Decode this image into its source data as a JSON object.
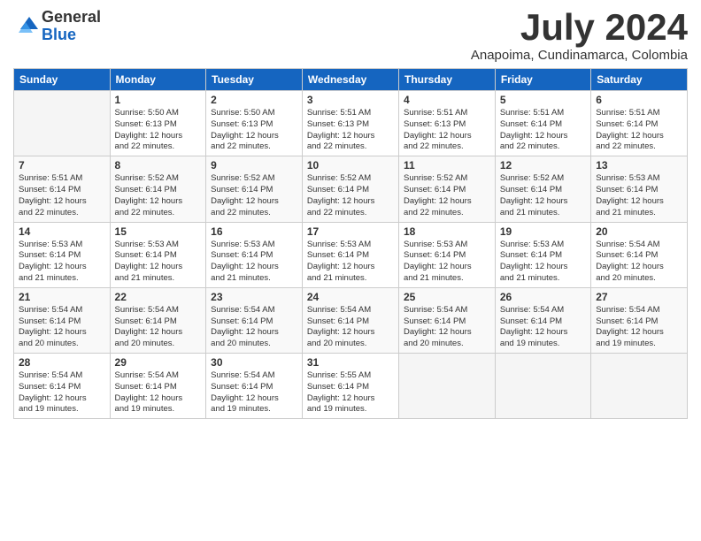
{
  "logo": {
    "general": "General",
    "blue": "Blue"
  },
  "header": {
    "month": "July 2024",
    "location": "Anapoima, Cundinamarca, Colombia"
  },
  "days_of_week": [
    "Sunday",
    "Monday",
    "Tuesday",
    "Wednesday",
    "Thursday",
    "Friday",
    "Saturday"
  ],
  "weeks": [
    [
      {
        "day": "",
        "info": ""
      },
      {
        "day": "1",
        "info": "Sunrise: 5:50 AM\nSunset: 6:13 PM\nDaylight: 12 hours\nand 22 minutes."
      },
      {
        "day": "2",
        "info": "Sunrise: 5:50 AM\nSunset: 6:13 PM\nDaylight: 12 hours\nand 22 minutes."
      },
      {
        "day": "3",
        "info": "Sunrise: 5:51 AM\nSunset: 6:13 PM\nDaylight: 12 hours\nand 22 minutes."
      },
      {
        "day": "4",
        "info": "Sunrise: 5:51 AM\nSunset: 6:13 PM\nDaylight: 12 hours\nand 22 minutes."
      },
      {
        "day": "5",
        "info": "Sunrise: 5:51 AM\nSunset: 6:14 PM\nDaylight: 12 hours\nand 22 minutes."
      },
      {
        "day": "6",
        "info": "Sunrise: 5:51 AM\nSunset: 6:14 PM\nDaylight: 12 hours\nand 22 minutes."
      }
    ],
    [
      {
        "day": "7",
        "info": "Sunrise: 5:51 AM\nSunset: 6:14 PM\nDaylight: 12 hours\nand 22 minutes."
      },
      {
        "day": "8",
        "info": "Sunrise: 5:52 AM\nSunset: 6:14 PM\nDaylight: 12 hours\nand 22 minutes."
      },
      {
        "day": "9",
        "info": "Sunrise: 5:52 AM\nSunset: 6:14 PM\nDaylight: 12 hours\nand 22 minutes."
      },
      {
        "day": "10",
        "info": "Sunrise: 5:52 AM\nSunset: 6:14 PM\nDaylight: 12 hours\nand 22 minutes."
      },
      {
        "day": "11",
        "info": "Sunrise: 5:52 AM\nSunset: 6:14 PM\nDaylight: 12 hours\nand 22 minutes."
      },
      {
        "day": "12",
        "info": "Sunrise: 5:52 AM\nSunset: 6:14 PM\nDaylight: 12 hours\nand 21 minutes."
      },
      {
        "day": "13",
        "info": "Sunrise: 5:53 AM\nSunset: 6:14 PM\nDaylight: 12 hours\nand 21 minutes."
      }
    ],
    [
      {
        "day": "14",
        "info": "Sunrise: 5:53 AM\nSunset: 6:14 PM\nDaylight: 12 hours\nand 21 minutes."
      },
      {
        "day": "15",
        "info": "Sunrise: 5:53 AM\nSunset: 6:14 PM\nDaylight: 12 hours\nand 21 minutes."
      },
      {
        "day": "16",
        "info": "Sunrise: 5:53 AM\nSunset: 6:14 PM\nDaylight: 12 hours\nand 21 minutes."
      },
      {
        "day": "17",
        "info": "Sunrise: 5:53 AM\nSunset: 6:14 PM\nDaylight: 12 hours\nand 21 minutes."
      },
      {
        "day": "18",
        "info": "Sunrise: 5:53 AM\nSunset: 6:14 PM\nDaylight: 12 hours\nand 21 minutes."
      },
      {
        "day": "19",
        "info": "Sunrise: 5:53 AM\nSunset: 6:14 PM\nDaylight: 12 hours\nand 21 minutes."
      },
      {
        "day": "20",
        "info": "Sunrise: 5:54 AM\nSunset: 6:14 PM\nDaylight: 12 hours\nand 20 minutes."
      }
    ],
    [
      {
        "day": "21",
        "info": "Sunrise: 5:54 AM\nSunset: 6:14 PM\nDaylight: 12 hours\nand 20 minutes."
      },
      {
        "day": "22",
        "info": "Sunrise: 5:54 AM\nSunset: 6:14 PM\nDaylight: 12 hours\nand 20 minutes."
      },
      {
        "day": "23",
        "info": "Sunrise: 5:54 AM\nSunset: 6:14 PM\nDaylight: 12 hours\nand 20 minutes."
      },
      {
        "day": "24",
        "info": "Sunrise: 5:54 AM\nSunset: 6:14 PM\nDaylight: 12 hours\nand 20 minutes."
      },
      {
        "day": "25",
        "info": "Sunrise: 5:54 AM\nSunset: 6:14 PM\nDaylight: 12 hours\nand 20 minutes."
      },
      {
        "day": "26",
        "info": "Sunrise: 5:54 AM\nSunset: 6:14 PM\nDaylight: 12 hours\nand 19 minutes."
      },
      {
        "day": "27",
        "info": "Sunrise: 5:54 AM\nSunset: 6:14 PM\nDaylight: 12 hours\nand 19 minutes."
      }
    ],
    [
      {
        "day": "28",
        "info": "Sunrise: 5:54 AM\nSunset: 6:14 PM\nDaylight: 12 hours\nand 19 minutes."
      },
      {
        "day": "29",
        "info": "Sunrise: 5:54 AM\nSunset: 6:14 PM\nDaylight: 12 hours\nand 19 minutes."
      },
      {
        "day": "30",
        "info": "Sunrise: 5:54 AM\nSunset: 6:14 PM\nDaylight: 12 hours\nand 19 minutes."
      },
      {
        "day": "31",
        "info": "Sunrise: 5:55 AM\nSunset: 6:14 PM\nDaylight: 12 hours\nand 19 minutes."
      },
      {
        "day": "",
        "info": ""
      },
      {
        "day": "",
        "info": ""
      },
      {
        "day": "",
        "info": ""
      }
    ]
  ]
}
